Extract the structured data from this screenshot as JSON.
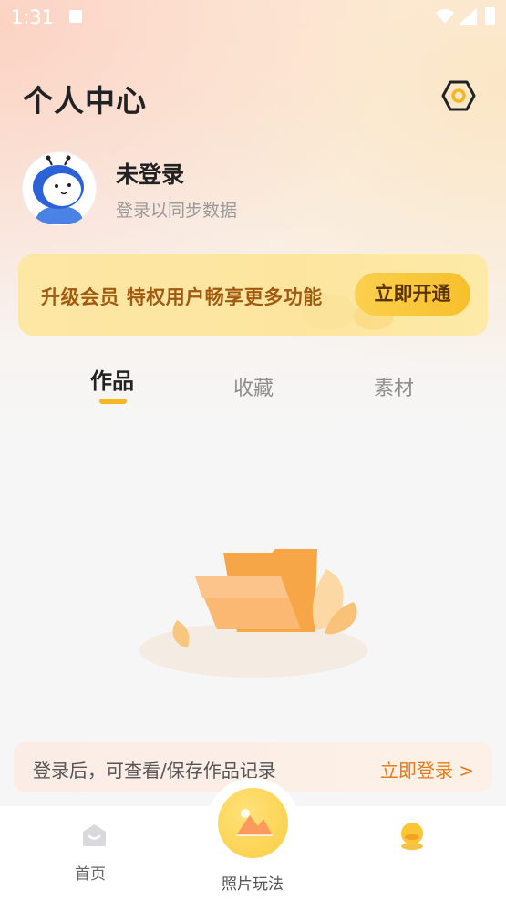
{
  "status_bar": {
    "time": "1:31"
  },
  "header": {
    "title": "个人中心"
  },
  "user": {
    "name": "未登录",
    "subtitle": "登录以同步数据"
  },
  "vip_banner": {
    "text": "升级会员 特权用户畅享更多功能",
    "button": "立即开通"
  },
  "tabs": [
    {
      "label": "作品",
      "active": true
    },
    {
      "label": "收藏",
      "active": false
    },
    {
      "label": "素材",
      "active": false
    }
  ],
  "login_prompt": {
    "hint": "登录后，可查看/保存作品记录",
    "action": "立即登录 >"
  },
  "bottom_nav": {
    "home": "首页",
    "center": "照片玩法"
  },
  "colors": {
    "accent": "#f5b622",
    "link": "#e87a17",
    "vip_text": "#a15a12"
  },
  "icons": {
    "settings": "gear-hexagon-icon",
    "home": "home-icon",
    "center": "photo-icon",
    "mine": "mine-avatar-icon"
  }
}
